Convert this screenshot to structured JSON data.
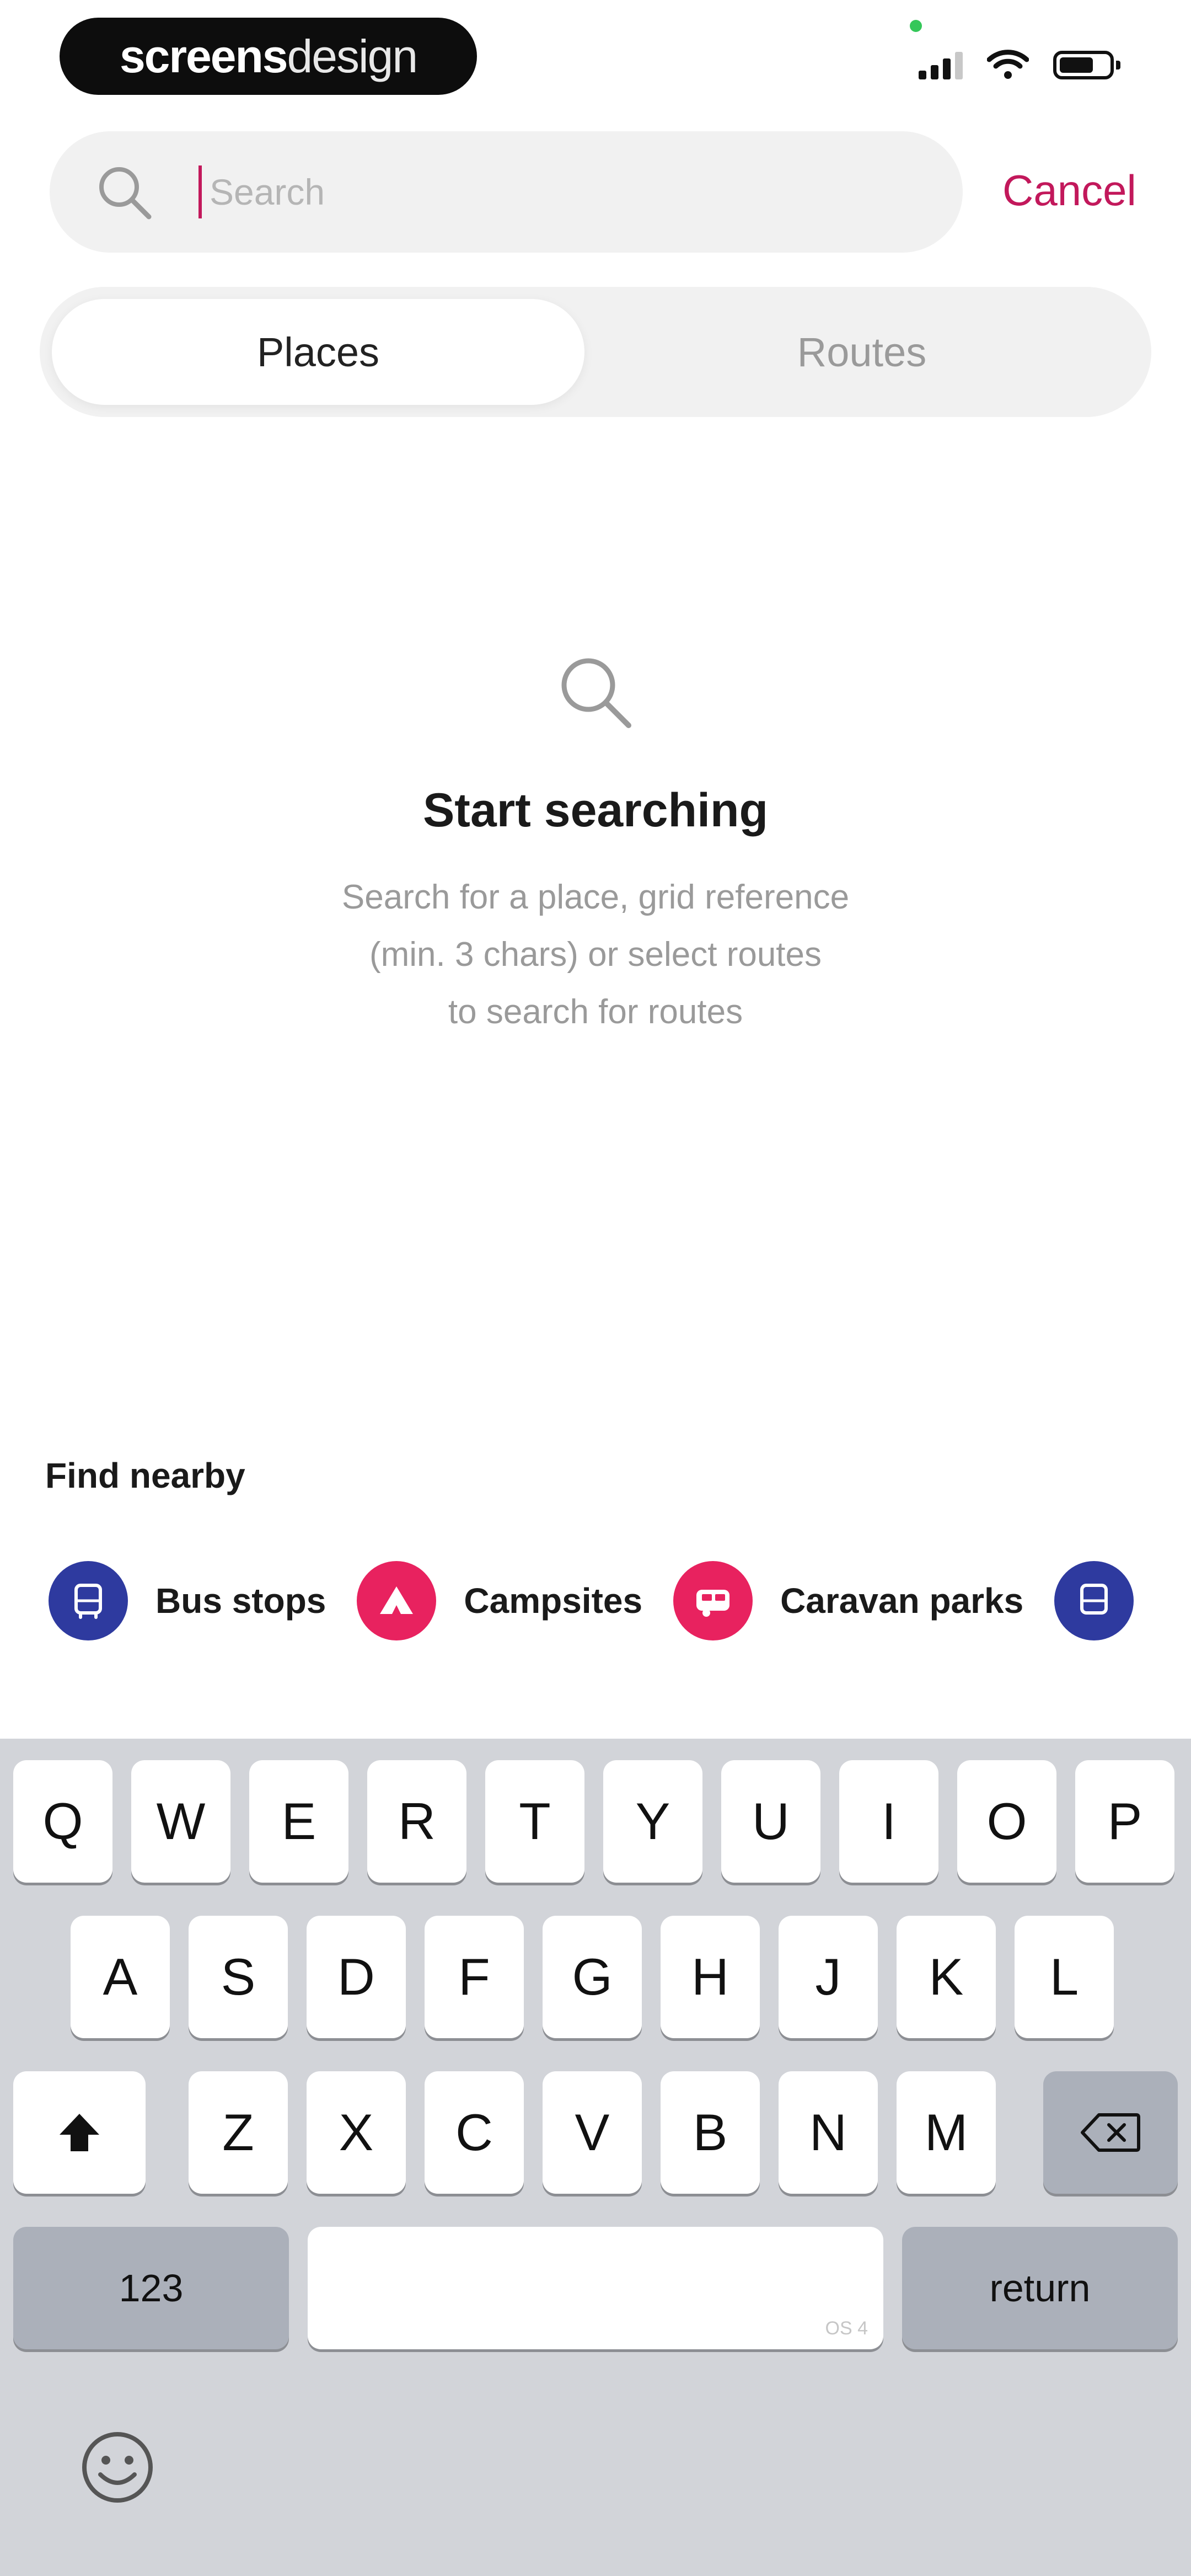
{
  "status_bar": {
    "logo_part1": "screens",
    "logo_part2": "design"
  },
  "search": {
    "placeholder": "Search",
    "value": "",
    "cancel_label": "Cancel"
  },
  "tabs": [
    {
      "label": "Places",
      "active": true
    },
    {
      "label": "Routes",
      "active": false
    }
  ],
  "empty_state": {
    "title": "Start searching",
    "line1": "Search for a place, grid reference",
    "line2": "(min. 3 chars) or select routes",
    "line3": "to search for routes"
  },
  "nearby": {
    "title": "Find nearby",
    "items": [
      {
        "label": "Bus stops",
        "icon": "bus-icon",
        "color": "#2e3a9f"
      },
      {
        "label": "Campsites",
        "icon": "tent-icon",
        "color": "#e8225f"
      },
      {
        "label": "Caravan parks",
        "icon": "caravan-icon",
        "color": "#e8225f"
      },
      {
        "label": "",
        "icon": "bus-icon",
        "color": "#2e3a9f"
      }
    ]
  },
  "keyboard": {
    "row1": [
      "Q",
      "W",
      "E",
      "R",
      "T",
      "Y",
      "U",
      "I",
      "O",
      "P"
    ],
    "row2": [
      "A",
      "S",
      "D",
      "F",
      "G",
      "H",
      "J",
      "K",
      "L"
    ],
    "row3": [
      "Z",
      "X",
      "C",
      "V",
      "B",
      "N",
      "M"
    ],
    "numbers_label": "123",
    "return_label": "return",
    "space_hint": "OS 4"
  },
  "colors": {
    "accent": "#c2185b",
    "navy": "#2e3a9f",
    "pink": "#e8225f",
    "keyboard_bg": "#d2d4d9"
  }
}
